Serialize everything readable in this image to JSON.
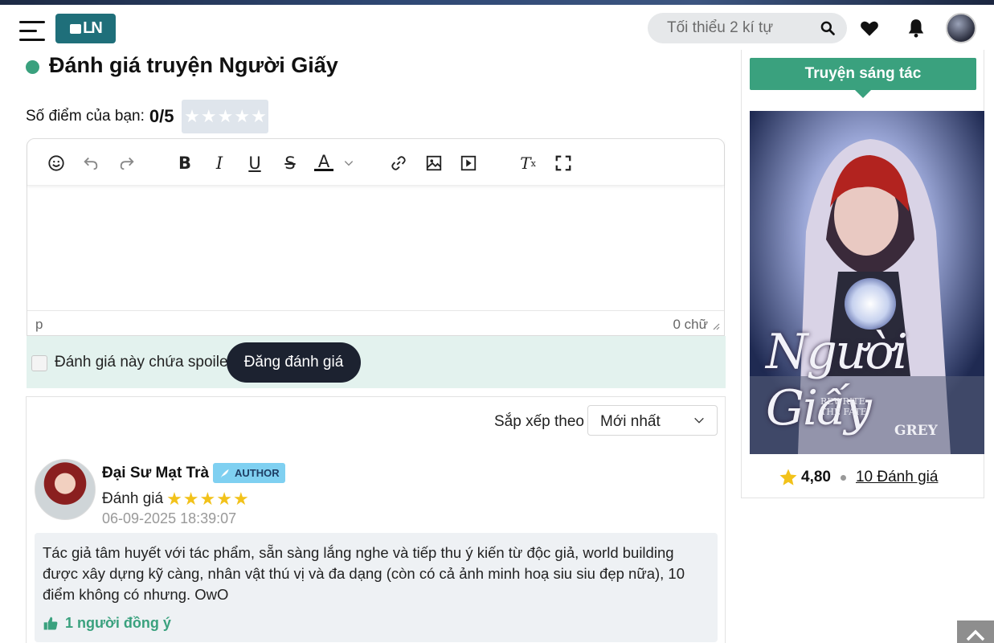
{
  "header": {
    "logo_text": "LN",
    "search_placeholder": "Tối thiểu 2 kí tự"
  },
  "page": {
    "title": "Đánh giá truyện Người Giấy"
  },
  "score": {
    "label": "Số điểm của bạn:",
    "value": "0/5"
  },
  "editor": {
    "toolbar": [
      "emoji-icon",
      "undo-icon",
      "redo-icon",
      "bold-icon",
      "italic-icon",
      "underline-icon",
      "strikethrough-icon",
      "text-color-icon",
      "link-icon",
      "image-icon",
      "media-icon",
      "clear-format-icon",
      "fullscreen-icon"
    ],
    "status_path": "p",
    "word_count": "0 chữ"
  },
  "spoiler": {
    "label": "Đánh giá này chứa spoiler",
    "submit_label": "Đăng đánh giá"
  },
  "sort": {
    "label": "Sắp xếp theo",
    "selected": "Mới nhất"
  },
  "review": {
    "author": "Đại Sư Mạt Trà",
    "badge": "AUTHOR",
    "rating_label": "Đánh giá",
    "stars": "★★★★★",
    "rating_value": 5,
    "date": "06-09-2025 18:39:07",
    "text": "Tác giả tâm huyết với tác phẩm, sẵn sàng lắng nghe và tiếp thu ý kiến từ độc giả, world building được xây dựng kỹ càng, nhân vật thú vị và đa dạng (còn có cả ảnh minh hoạ siu siu đẹp nữa), 10 điểm không có nhưng. OwO",
    "likes": "1 người đồng ý"
  },
  "sidebar": {
    "title": "Truyện sáng tác",
    "cover_title": "Người Giấy",
    "cover_subtitle_1": "REWRITE",
    "cover_subtitle_2": "THE FATE",
    "cover_author": "GREY",
    "rating": "4,80",
    "reviews_link": "10 Đánh giá"
  },
  "colors": {
    "accent": "#3aa17e",
    "dark_button": "#1c2230",
    "badge": "#7fd0f1",
    "star": "#f2c21a"
  }
}
